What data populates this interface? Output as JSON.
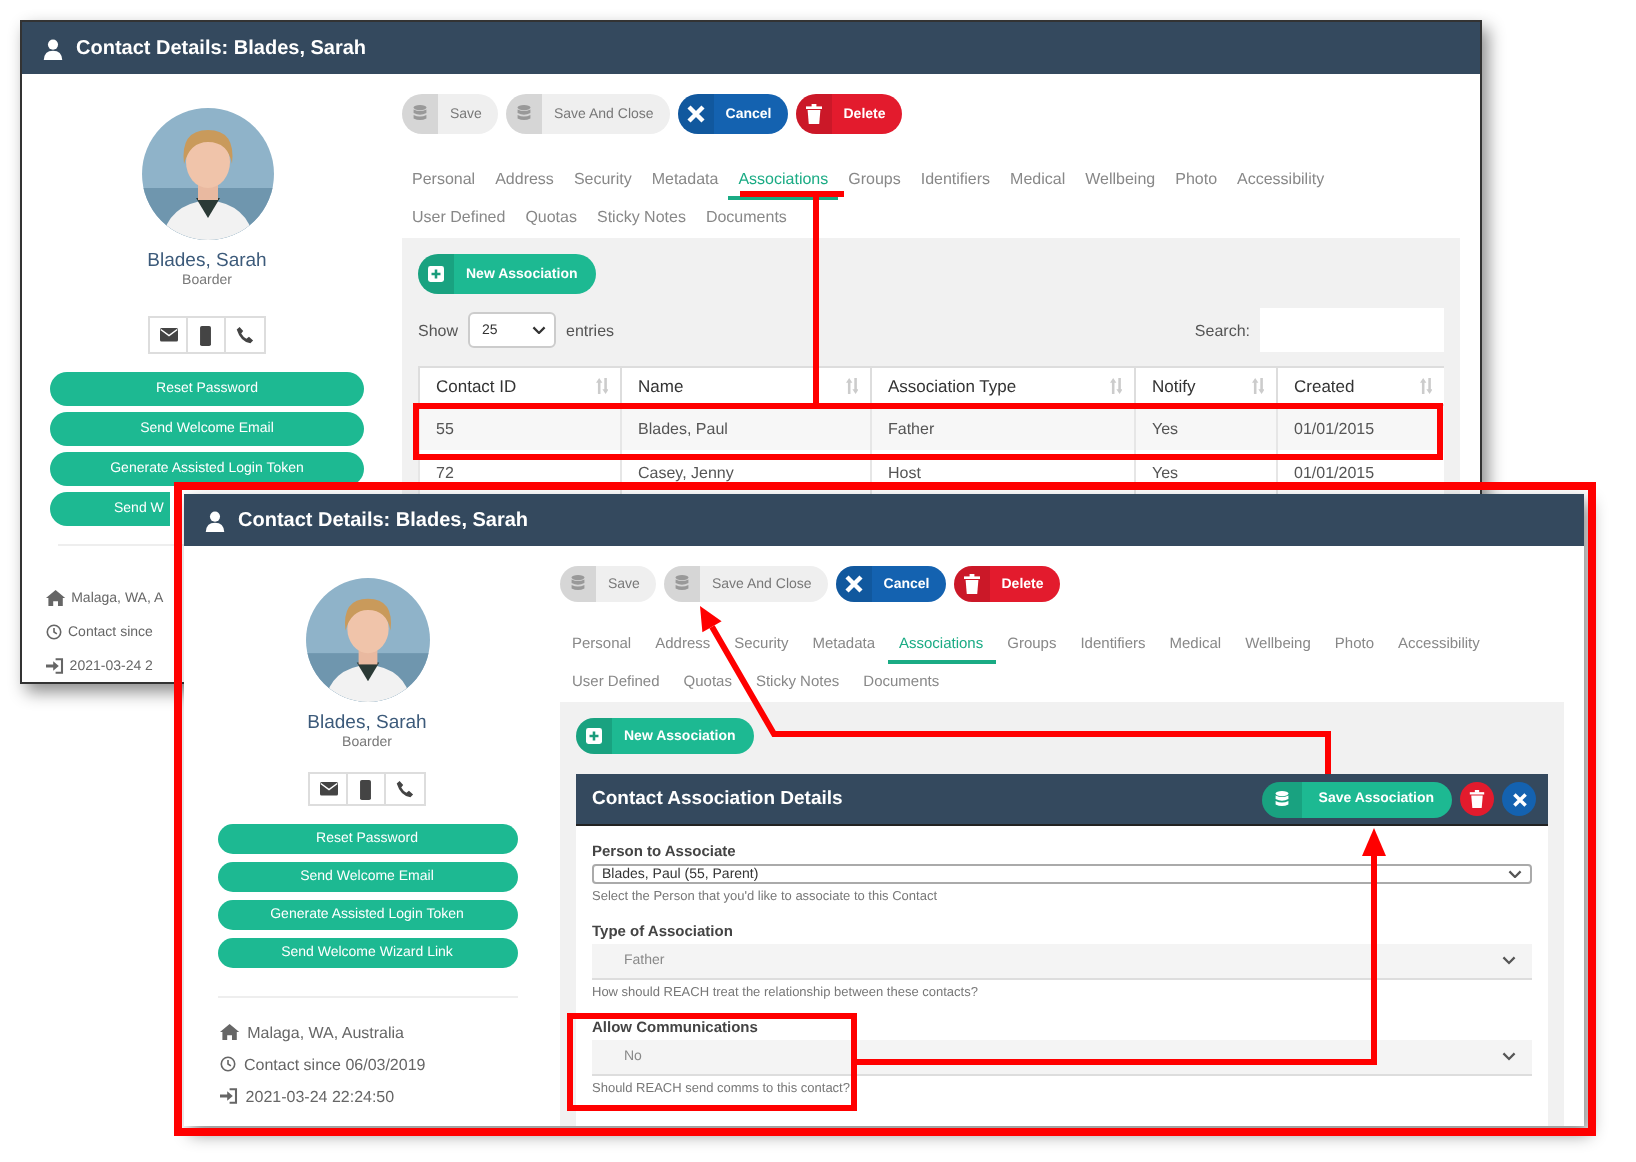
{
  "back_window": {
    "title": "Contact Details: Blades, Sarah",
    "profile": {
      "name": "Blades, Sarah",
      "role": "Boarder"
    },
    "actions": [
      "Reset Password",
      "Send Welcome Email",
      "Generate Assisted Login Token",
      "Send W"
    ],
    "details": [
      {
        "kind": "home",
        "text": "Malaga, WA, A"
      },
      {
        "kind": "clock",
        "text": "Contact since"
      },
      {
        "kind": "login",
        "text": "2021-03-24 2"
      }
    ],
    "toolbar": [
      {
        "label": "Save",
        "kind": "save"
      },
      {
        "label": "Save And Close",
        "kind": "save"
      },
      {
        "label": "Cancel",
        "kind": "cancel"
      },
      {
        "label": "Delete",
        "kind": "delete"
      }
    ],
    "tab_rows": [
      [
        {
          "label": "Personal",
          "selected": false
        },
        {
          "label": "Address",
          "selected": false
        },
        {
          "label": "Security",
          "selected": false
        },
        {
          "label": "Metadata",
          "selected": false
        },
        {
          "label": "Associations",
          "selected": true
        },
        {
          "label": "Groups",
          "selected": false
        },
        {
          "label": "Identifiers",
          "selected": false
        },
        {
          "label": "Medical",
          "selected": false
        },
        {
          "label": "Wellbeing",
          "selected": false
        },
        {
          "label": "Photo",
          "selected": false
        },
        {
          "label": "Accessibility",
          "selected": false
        }
      ],
      [
        {
          "label": "User Defined",
          "selected": false
        },
        {
          "label": "Quotas",
          "selected": false
        },
        {
          "label": "Sticky Notes",
          "selected": false
        },
        {
          "label": "Documents",
          "selected": false
        }
      ]
    ],
    "new_button": "New Association",
    "table": {
      "show_label": "Show",
      "page_size": "25",
      "entries_label": "entries",
      "search_label": "Search:",
      "columns": [
        "Contact ID",
        "Name",
        "Association Type",
        "Notify",
        "Created"
      ],
      "rows": [
        [
          "55",
          "Blades, Paul",
          "Father",
          "Yes",
          "01/01/2015"
        ],
        [
          "72",
          "Casey, Jenny",
          "Host",
          "Yes",
          "01/01/2015"
        ]
      ]
    }
  },
  "front_window": {
    "title": "Contact Details: Blades, Sarah",
    "profile": {
      "name": "Blades, Sarah",
      "role": "Boarder"
    },
    "actions": [
      "Reset Password",
      "Send Welcome Email",
      "Generate Assisted Login Token",
      "Send Welcome Wizard Link"
    ],
    "details": [
      {
        "kind": "home",
        "text": "Malaga, WA, Australia"
      },
      {
        "kind": "clock",
        "text": "Contact since 06/03/2019"
      },
      {
        "kind": "login",
        "text": "2021-03-24 22:24:50"
      }
    ],
    "toolbar": [
      {
        "label": "Save",
        "kind": "save"
      },
      {
        "label": "Save And Close",
        "kind": "save"
      },
      {
        "label": "Cancel",
        "kind": "cancel"
      },
      {
        "label": "Delete",
        "kind": "delete"
      }
    ],
    "tab_rows": [
      [
        {
          "label": "Personal",
          "selected": false
        },
        {
          "label": "Address",
          "selected": false
        },
        {
          "label": "Security",
          "selected": false
        },
        {
          "label": "Metadata",
          "selected": false
        },
        {
          "label": "Associations",
          "selected": true
        },
        {
          "label": "Groups",
          "selected": false
        },
        {
          "label": "Identifiers",
          "selected": false
        },
        {
          "label": "Medical",
          "selected": false
        },
        {
          "label": "Wellbeing",
          "selected": false
        },
        {
          "label": "Photo",
          "selected": false
        },
        {
          "label": "Accessibility",
          "selected": false
        }
      ],
      [
        {
          "label": "User Defined",
          "selected": false
        },
        {
          "label": "Quotas",
          "selected": false
        },
        {
          "label": "Sticky Notes",
          "selected": false
        },
        {
          "label": "Documents",
          "selected": false
        }
      ]
    ],
    "new_button": "New Association",
    "form": {
      "title": "Contact Association Details",
      "save_label": "Save Association",
      "fields": [
        {
          "label": "Person to Associate",
          "value": "Blades, Paul (55, Parent)",
          "help": "Select the Person that you'd like to associate to this Contact",
          "disabled": false
        },
        {
          "label": "Type of Association",
          "value": "Father",
          "help": "How should REACH treat the relationship between these contacts?",
          "disabled": true
        },
        {
          "label": "Allow Communications",
          "value": "No",
          "help": "Should REACH send comms to this contact?",
          "disabled": true
        }
      ]
    }
  }
}
